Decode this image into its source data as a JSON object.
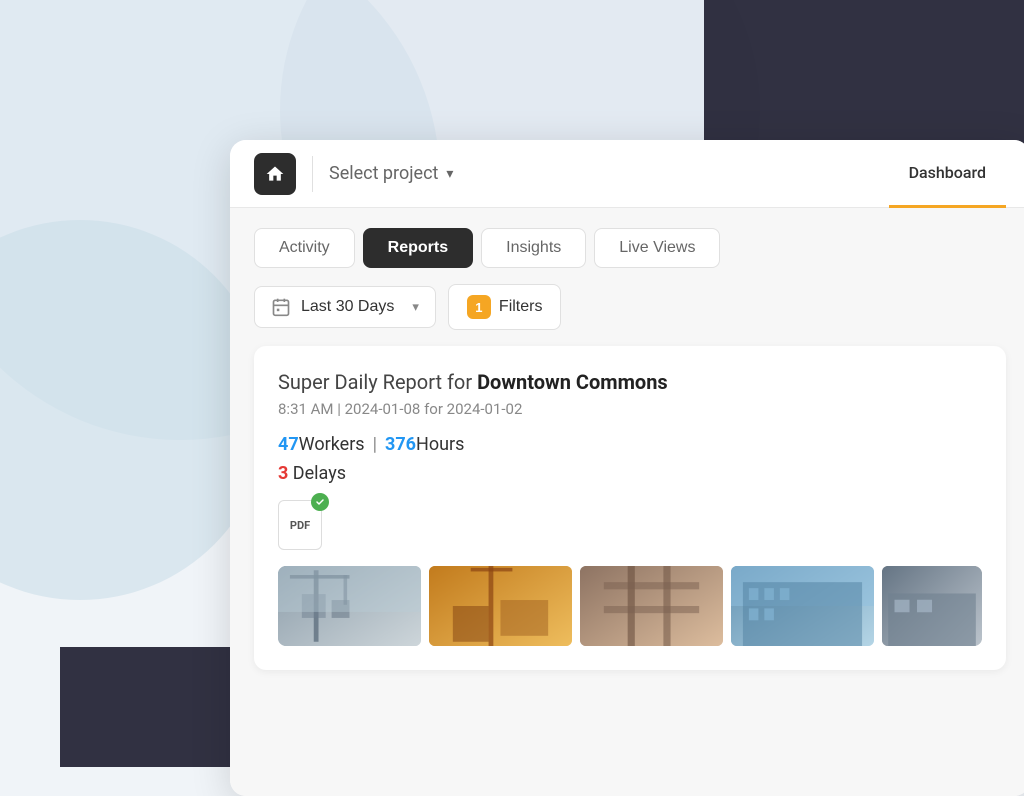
{
  "background": {
    "colors": {
      "primary": "#d8e6f0",
      "dark": "#1a1a2e"
    }
  },
  "header": {
    "home_btn_label": "Home",
    "select_project_label": "Select project",
    "chevron": "▾",
    "dashboard_tab_label": "Dashboard"
  },
  "tabs": {
    "items": [
      {
        "id": "activity",
        "label": "Activity",
        "active": false
      },
      {
        "id": "reports",
        "label": "Reports",
        "active": true
      },
      {
        "id": "insights",
        "label": "Insights",
        "active": false
      },
      {
        "id": "live-views",
        "label": "Live Views",
        "active": false
      }
    ]
  },
  "filters": {
    "date_range_label": "Last 30 Days",
    "chevron": "▾",
    "filter_label": "Filters",
    "filter_count": "1"
  },
  "report": {
    "title_prefix": "Super Daily Report for ",
    "title_bold": "Downtown Commons",
    "meta": "8:31 AM | 2024-01-08 for 2024-01-02",
    "workers_count": "47",
    "workers_label": " Workers",
    "divider": "|",
    "hours_count": "376",
    "hours_label": " Hours",
    "delays_count": "3",
    "delays_label": " Delays",
    "pdf_label": "PDF",
    "pdf_checkmark": "✓"
  }
}
